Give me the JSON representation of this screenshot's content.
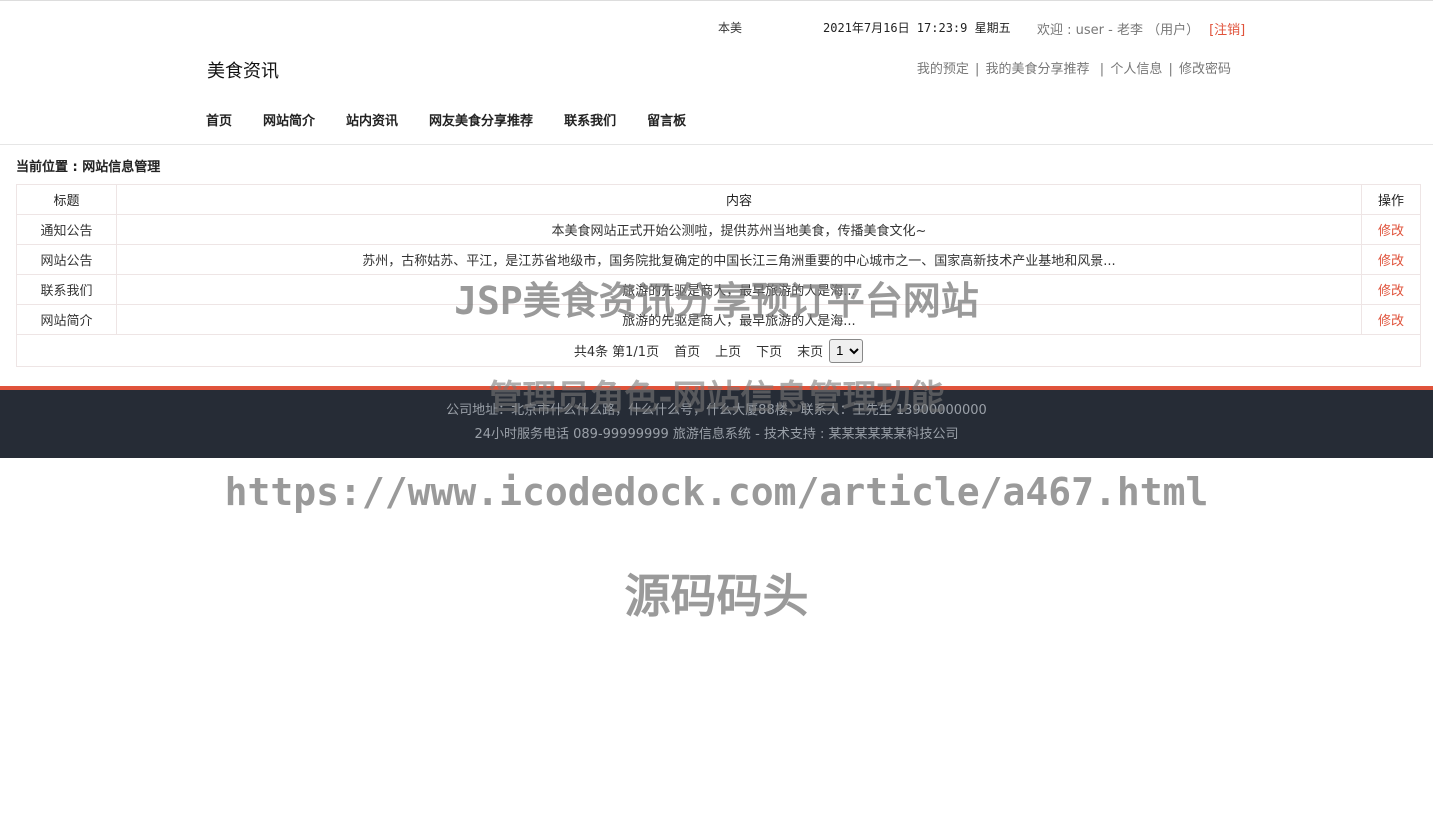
{
  "top": {
    "marquee": "本美",
    "datetime": "2021年7月16日 17:23:9 星期五",
    "welcome": "欢迎 : user - 老李 （用户）",
    "logout": "[注销]"
  },
  "header": {
    "site_title": "美食资讯",
    "user_links": [
      "我的预定",
      "我的美食分享推荐",
      "个人信息",
      "修改密码"
    ]
  },
  "nav": {
    "items": [
      "首页",
      "网站简介",
      "站内资讯",
      "网友美食分享推荐",
      "联系我们",
      "留言板"
    ]
  },
  "breadcrumb": "当前位置 : 网站信息管理",
  "table": {
    "headers": [
      "标题",
      "内容",
      "操作"
    ],
    "rows": [
      {
        "title": "通知公告",
        "content": "本美食网站正式开始公测啦，提供苏州当地美食，传播美食文化~",
        "action": "修改"
      },
      {
        "title": "网站公告",
        "content": "苏州，古称姑苏、平江，是江苏省地级市，国务院批复确定的中国长江三角洲重要的中心城市之一、国家高新技术产业基地和风景...",
        "action": "修改"
      },
      {
        "title": "联系我们",
        "content": "旅游的先驱是商人，最早旅游的人是海...",
        "action": "修改"
      },
      {
        "title": "网站简介",
        "content": "旅游的先驱是商人，最早旅游的人是海...",
        "action": "修改"
      }
    ]
  },
  "pager": {
    "total": "共4条",
    "page_info": "第1/1页",
    "first": "首页",
    "prev": "上页",
    "next": "下页",
    "last": "末页",
    "selected_page": "1"
  },
  "footer": {
    "line1": "公司地址：北京市什么什么路，什么什么号，什么大厦88楼，联系人：王先生 13900000000",
    "line2": "24小时服务电话   089-99999999   旅游信息系统 - 技术支持 : 某某某某某某科技公司"
  },
  "watermarks": {
    "title": "JSP美食资讯分享预订平台网站",
    "subtitle": "管理员角色-网站信息管理功能",
    "url": "https://www.icodedock.com/article/a467.html",
    "brand": "源码码头"
  },
  "colors": {
    "accent": "#e0533b",
    "footer_bg": "#262c36"
  }
}
